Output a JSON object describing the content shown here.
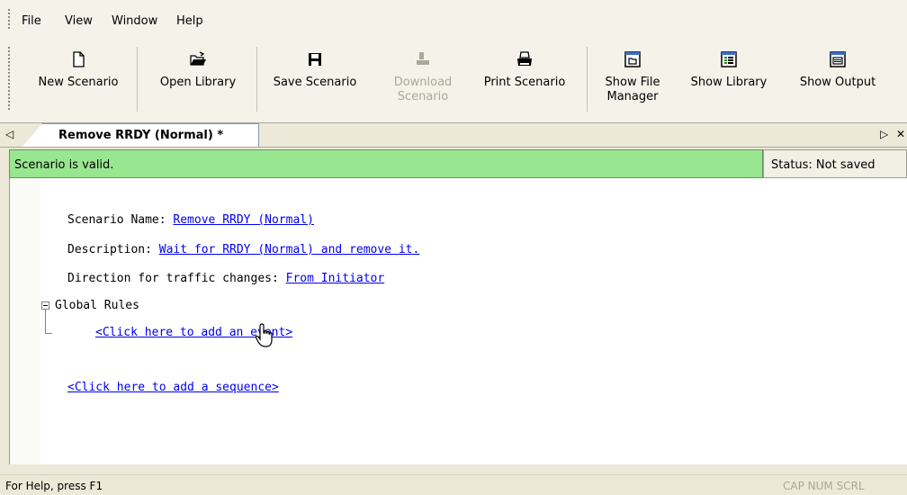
{
  "menu": [
    "File",
    "View",
    "Window",
    "Help"
  ],
  "toolbar": {
    "new_scenario": "New Scenario",
    "open_library": "Open Library",
    "save_scenario": "Save Scenario",
    "download_1": "Download",
    "download_2": "Scenario",
    "print_scenario": "Print Scenario",
    "show_file_manager_1": "Show File",
    "show_file_manager_2": "Manager",
    "show_library": "Show Library",
    "show_output": "Show Output"
  },
  "tab": {
    "title": "Remove RRDY (Normal) *",
    "scroll_left": "◁",
    "scroll_right": "▷",
    "close": "✕"
  },
  "validation": {
    "message": "Scenario is valid.",
    "save_status": "Status: Not saved"
  },
  "scenario": {
    "name_label": "Scenario Name: ",
    "name_value": "Remove RRDY (Normal)",
    "desc_label": "Description: ",
    "desc_value": "Wait for RRDY (Normal) and remove it.",
    "dir_label": "Direction for traffic changes: ",
    "dir_value": "From Initiator",
    "global_rules": "Global Rules",
    "add_event": "<Click here to add an event>",
    "add_sequence": "<Click here to add a sequence>"
  },
  "statusbar": {
    "help": "For Help, press F1",
    "keys": "CAP NUM SCRL"
  },
  "colors": {
    "valid_bg": "#99e691",
    "link": "#0000ee",
    "chrome": "#ece9d8"
  }
}
